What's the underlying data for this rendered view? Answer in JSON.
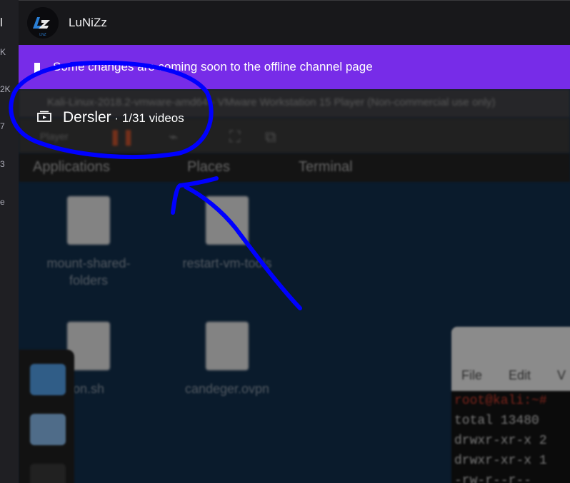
{
  "sidebar": {
    "items": [
      "l",
      "K",
      "2K",
      "7",
      "3",
      "e"
    ]
  },
  "channel": {
    "name": "LuNiZz",
    "logo_text": "LNZ"
  },
  "banner": {
    "text": "Some changes are coming soon to the offline channel page"
  },
  "playlist": {
    "title": "Dersler",
    "count": " · 1/31 videos"
  },
  "video": {
    "window_title": "Kali-Linux-2018.2-vmware-amd64 - VMware Workstation 15 Player (Non-commercial use only)",
    "player_label": "Player",
    "gnome_menu": [
      "Applications",
      "Places",
      "Terminal"
    ],
    "desktop_icons": [
      {
        "label": "mount-shared-folders"
      },
      {
        "label": "restart-vm-tools"
      },
      {
        "label": "on.sh"
      },
      {
        "label": "candeger.ovpn"
      }
    ],
    "terminal": {
      "menu": [
        "File",
        "Edit",
        "V"
      ],
      "lines": [
        "root@kali:~#",
        "total 13480",
        "drwxr-xr-x 2",
        "drwxr-xr-x 1",
        "-rw-r--r--"
      ]
    }
  },
  "colors": {
    "banner": "#772ce8",
    "annotation": "#0000ff",
    "background": "#0e0e10"
  }
}
